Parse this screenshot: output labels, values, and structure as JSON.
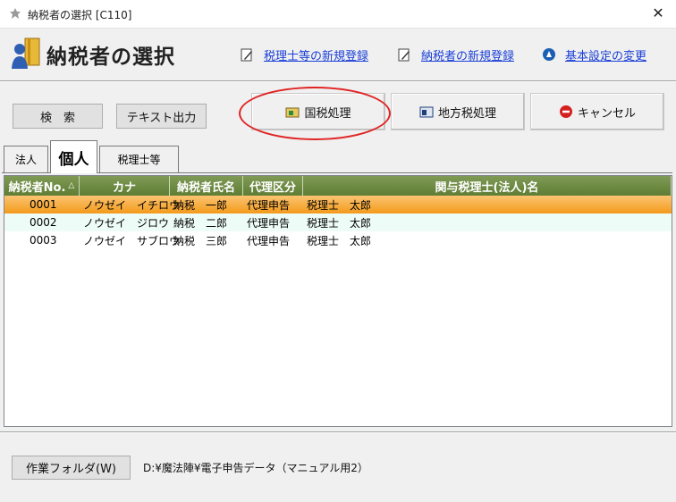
{
  "window": {
    "title": "納税者の選択 [C110]",
    "close_glyph": "✕"
  },
  "header": {
    "title": "納税者の選択",
    "links": [
      {
        "label": "税理士等の新規登録",
        "icon": "edit-icon"
      },
      {
        "label": "納税者の新規登録",
        "icon": "edit-icon"
      },
      {
        "label": "基本設定の変更",
        "icon": "settings-icon"
      }
    ]
  },
  "toolbar": {
    "search_label": "検　索",
    "text_output_label": "テキスト出力",
    "national_tax_label": "国税処理",
    "local_tax_label": "地方税処理",
    "cancel_label": "キャンセル"
  },
  "tabs": [
    {
      "label": "法人",
      "active": false
    },
    {
      "label": "個人",
      "active": true
    },
    {
      "label": "税理士等",
      "active": false
    }
  ],
  "grid": {
    "columns": [
      "納税者No.",
      "カナ",
      "納税者氏名",
      "代理区分",
      "関与税理士(法人)名"
    ],
    "sort_indicator": "△",
    "rows": [
      {
        "no": "0001",
        "kana": "ノウゼイ　イチロウ",
        "name": "納税　一郎",
        "type": "代理申告",
        "advisor": "税理士　太郎",
        "selected": true
      },
      {
        "no": "0002",
        "kana": "ノウゼイ　ジロウ",
        "name": "納税　二郎",
        "type": "代理申告",
        "advisor": "税理士　太郎",
        "selected": false
      },
      {
        "no": "0003",
        "kana": "ノウゼイ　サブロウ",
        "name": "納税　三郎",
        "type": "代理申告",
        "advisor": "税理士　太郎",
        "selected": false
      }
    ]
  },
  "footer": {
    "work_folder_label": "作業フォルダ(W)",
    "work_folder_path": "D:¥魔法陣¥電子申告データ（マニュアル用2）"
  },
  "colors": {
    "link": "#1a3fd6",
    "grid_header": "#6b8a3f",
    "selected_row": "#f5a93a",
    "annotation": "#e02424"
  }
}
